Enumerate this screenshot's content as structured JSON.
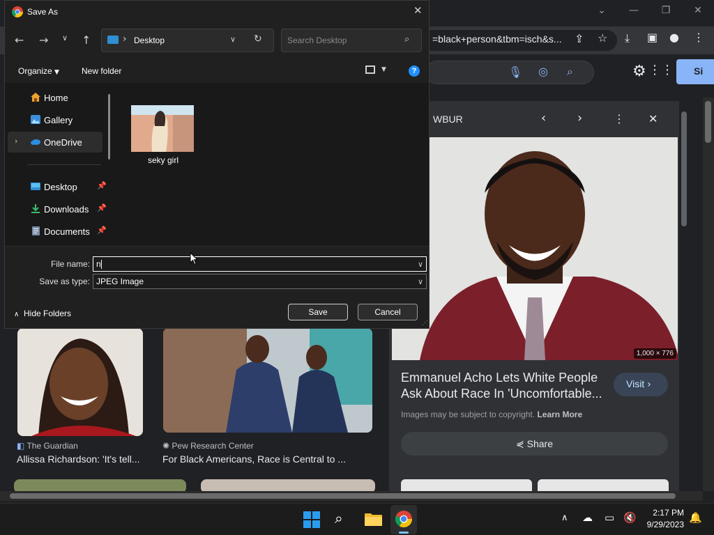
{
  "dialog": {
    "title": "Save As",
    "address": "Desktop",
    "search_placeholder": "Search Desktop",
    "organize_label": "Organize",
    "new_folder_label": "New folder",
    "nav_items": [
      {
        "label": "Home"
      },
      {
        "label": "Gallery"
      },
      {
        "label": "OneDrive"
      },
      {
        "label": "Desktop"
      },
      {
        "label": "Downloads"
      },
      {
        "label": "Documents"
      }
    ],
    "files": [
      {
        "name": "seky girl"
      }
    ],
    "file_name_label": "File name:",
    "file_name_value": "n",
    "save_type_label": "Save as type:",
    "save_type_value": "JPEG Image",
    "hide_folders_label": "Hide Folders",
    "save_label": "Save",
    "cancel_label": "Cancel"
  },
  "browser": {
    "url_fragment": "=black+person&tbm=isch&s...",
    "signin_label": "Si",
    "results": [
      {
        "source": "The Guardian",
        "title": "Allissa Richardson: 'It's tell..."
      },
      {
        "source": "Pew Research Center",
        "title": "For Black Americans, Race is Central to ..."
      }
    ],
    "preview": {
      "source": "WBUR",
      "dimensions": "1,000 × 776",
      "title": "Emmanuel Acho Lets White People Ask About Race In 'Uncomfortable...",
      "visit_label": "Visit",
      "copyright_text": "Images may be subject to copyright.",
      "learn_more": "Learn More",
      "share_label": "Share"
    }
  },
  "taskbar": {
    "time": "2:17 PM",
    "date": "9/29/2023"
  }
}
